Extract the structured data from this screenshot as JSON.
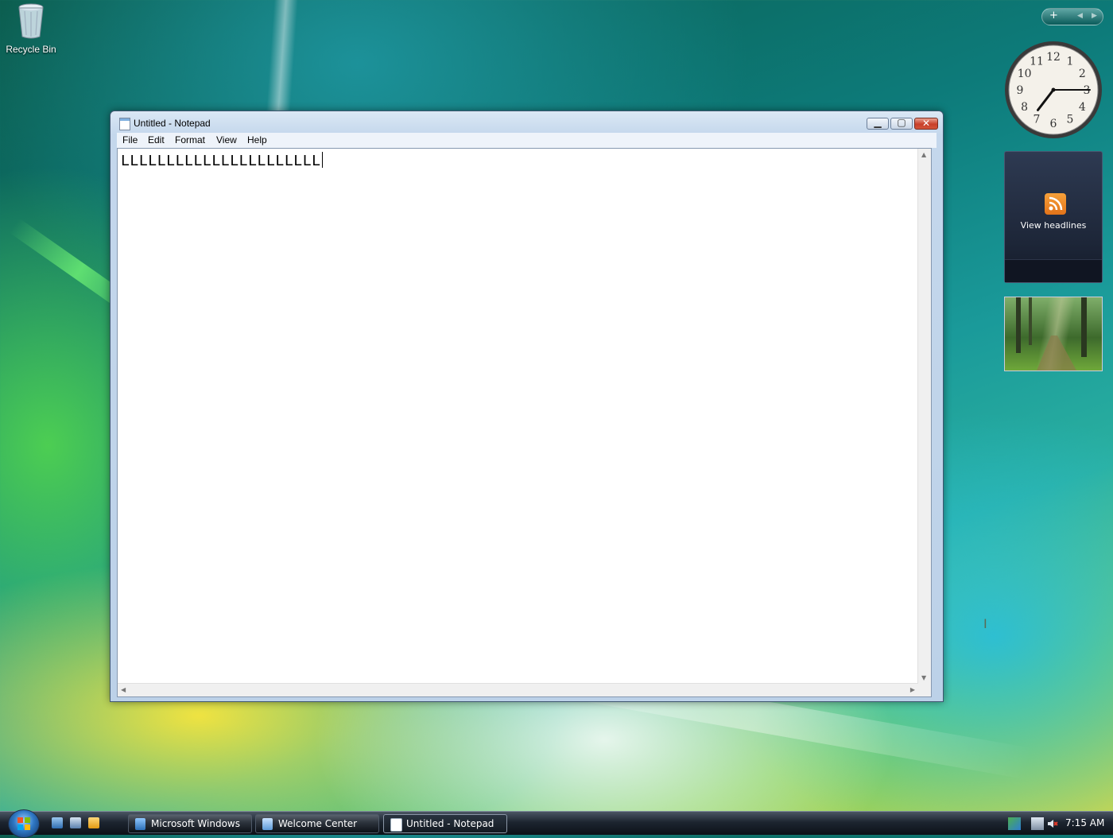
{
  "desktop": {
    "recycle_bin_label": "Recycle Bin"
  },
  "notepad": {
    "title": "Untitled - Notepad",
    "menu": [
      "File",
      "Edit",
      "Format",
      "View",
      "Help"
    ],
    "content": "LLLLLLLLLLLLLLLLLLLLLL",
    "buttons": {
      "minimize": "minimize-icon",
      "maximize": "maximize-icon",
      "close": "close-icon"
    }
  },
  "gadgets": {
    "clock": {
      "hour": 7,
      "minute": 15,
      "numerals": [
        "12",
        "1",
        "2",
        "3",
        "4",
        "5",
        "6",
        "7",
        "8",
        "9",
        "10",
        "11"
      ]
    },
    "feed": {
      "label": "View headlines",
      "icon": "rss-icon"
    },
    "slideshow": {
      "icon": "forest-photo"
    }
  },
  "taskbar": {
    "buttons": [
      {
        "label": "Microsoft Windows"
      },
      {
        "label": "Welcome Center"
      },
      {
        "label": "Untitled - Notepad",
        "active": true
      }
    ],
    "time": "7:15 AM"
  },
  "colors": {
    "close_button": "#c8402a",
    "rss": "#e2731a",
    "taskbar": "#1d2530"
  }
}
